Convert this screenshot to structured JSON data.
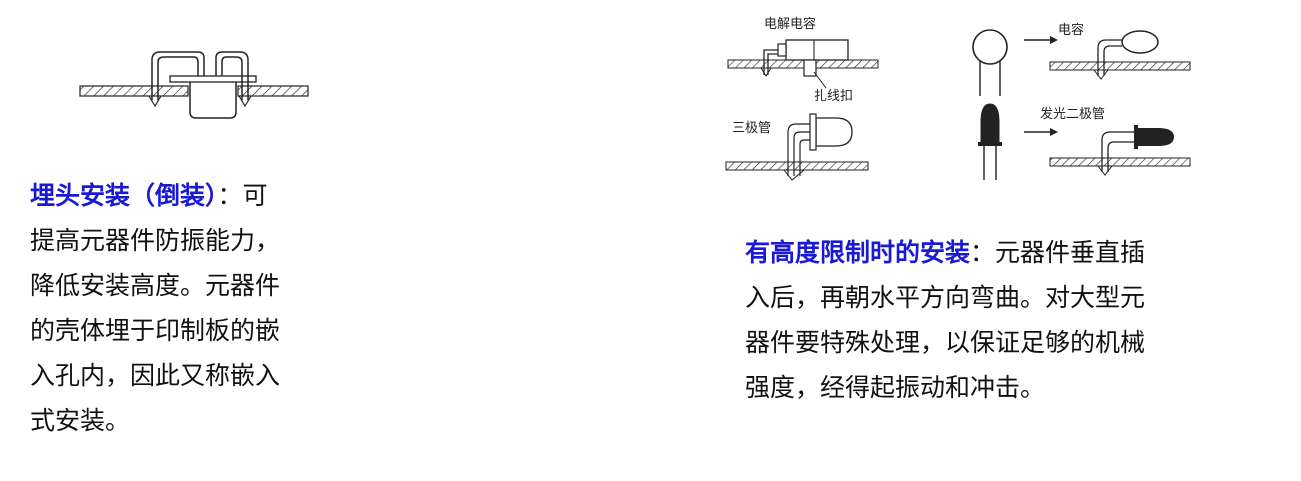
{
  "left": {
    "heading": "埋头安装（倒装）",
    "colon": "：",
    "body": "可\n提高元器件防振能力，\n降低安装高度。元器件\n的壳体埋于印制板的嵌\n入孔内，因此又称嵌入\n式安装。"
  },
  "right": {
    "heading": "有高度限制时的安装",
    "colon": "：",
    "body": "元器件垂直插\n入后，再朝水平方向弯曲。对大型元\n器件要特殊处理，以保证足够的机械\n强度，经得起振动和冲击。"
  },
  "diagram": {
    "label_electrolytic": "电解电容",
    "label_cable_tie": "扎线扣",
    "label_transistor": "三极管",
    "label_capacitor": "电容",
    "label_led": "发光二极管"
  },
  "colors": {
    "highlight": "#1a1ad6",
    "text": "#111111",
    "diagram": "#222222"
  }
}
